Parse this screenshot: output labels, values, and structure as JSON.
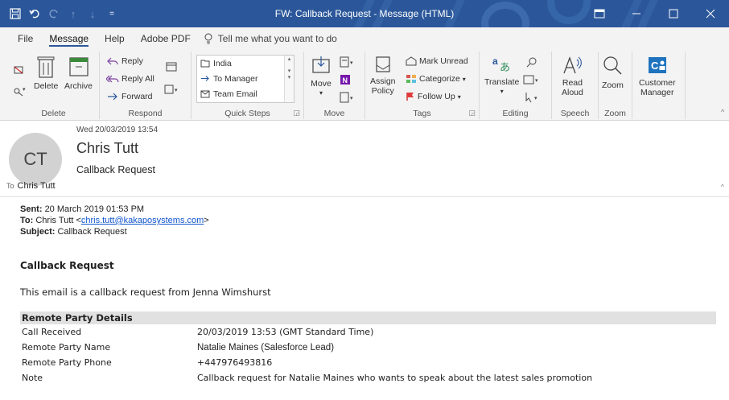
{
  "window": {
    "title": "FW: Callback Request  -  Message (HTML)",
    "qat": [
      "save-icon",
      "undo-icon",
      "redo-icon",
      "up-icon",
      "down-icon",
      "customize-icon"
    ]
  },
  "menu": {
    "tabs": [
      "File",
      "Message",
      "Help",
      "Adobe PDF"
    ],
    "active_tab": "Message",
    "tell_me": "Tell me what you want to do"
  },
  "ribbon": {
    "delete_group": {
      "label": "Delete",
      "delete": "Delete",
      "archive": "Archive"
    },
    "respond_group": {
      "label": "Respond",
      "reply": "Reply",
      "reply_all": "Reply All",
      "forward": "Forward"
    },
    "quick_steps_group": {
      "label": "Quick Steps",
      "items": [
        "India",
        "To Manager",
        "Team Email"
      ]
    },
    "move_group": {
      "label": "Move",
      "move": "Move"
    },
    "tags_group": {
      "label": "Tags",
      "mark_unread": "Mark Unread",
      "categorize": "Categorize",
      "follow_up": "Follow Up",
      "assign": "Assign",
      "policy": "Policy"
    },
    "editing_group": {
      "label": "Editing",
      "translate": "Translate"
    },
    "speech_group": {
      "label": "Speech",
      "read": "Read",
      "aloud": "Aloud"
    },
    "zoom_group": {
      "label": "Zoom",
      "zoom": "Zoom"
    },
    "customer_group": {
      "customer": "Customer",
      "manager": "Manager"
    }
  },
  "message": {
    "date": "Wed 20/03/2019 13:54",
    "avatar_initials": "CT",
    "from": "Chris Tutt",
    "subject": "Callback Request",
    "to_label": "To",
    "to": "Chris Tutt"
  },
  "body": {
    "sent_label": "Sent:",
    "sent": "20 March 2019 01:53 PM",
    "to_label": "To:",
    "to_name": "Chris Tutt <",
    "to_email": "chris.tutt@kakaposystems.com",
    "to_close": ">",
    "subject_label": "Subject:",
    "subject": "Callback Request",
    "heading": "Callback Request",
    "intro": "This email is a callback request from Jenna Wimshurst",
    "details_heading": "Remote Party Details",
    "details": [
      {
        "label": "Call Received",
        "value": "20/03/2019 13:53 (GMT Standard Time)"
      },
      {
        "label": "Remote Party Name",
        "value": "Natalie Maines (Salesforce Lead)"
      },
      {
        "label": "Remote Party Phone",
        "value": "+447976493816"
      },
      {
        "label": "Note",
        "value": "Callback request for Natalie Maines who wants to speak about the latest sales promotion"
      }
    ]
  },
  "colors": {
    "titlebar": "#2b579a",
    "ribbon": "#f3f3f3",
    "link": "#1155cc",
    "table_header": "#e1e1e1"
  }
}
